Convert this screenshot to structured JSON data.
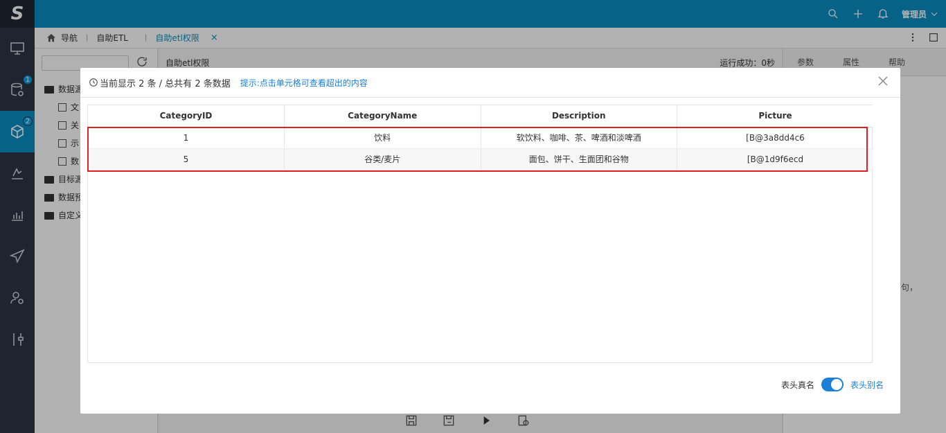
{
  "rail": {
    "logo": "S",
    "items": [
      {
        "icon": "monitor-icon",
        "badge": ""
      },
      {
        "icon": "database-settings-icon",
        "badge": "1"
      },
      {
        "icon": "cube-icon",
        "badge": "2",
        "active": true
      },
      {
        "icon": "chart-draw-icon",
        "badge": ""
      },
      {
        "icon": "bar-chart-icon",
        "badge": ""
      },
      {
        "icon": "send-icon",
        "badge": ""
      },
      {
        "icon": "user-settings-icon",
        "badge": ""
      },
      {
        "icon": "tools-icon",
        "badge": ""
      }
    ]
  },
  "topbar": {
    "user_label": "管理员"
  },
  "tabs": {
    "home_label": "导航",
    "items": [
      {
        "label": "自助ETL"
      },
      {
        "label": "自助etl权限",
        "active": true
      }
    ],
    "close_glyph": "×"
  },
  "left_pane": {
    "tree": [
      {
        "label": "数据源",
        "type": "folder"
      },
      {
        "label": "文",
        "type": "child"
      },
      {
        "label": "关",
        "type": "child"
      },
      {
        "label": "示",
        "type": "child"
      },
      {
        "label": "数",
        "type": "child"
      },
      {
        "label": "目标源",
        "type": "folder"
      },
      {
        "label": "数据预",
        "type": "folder"
      },
      {
        "label": "自定义",
        "type": "folder"
      }
    ]
  },
  "center_pane": {
    "title": "自助etl权限",
    "status": "运行成功：0秒"
  },
  "right_pane": {
    "tabs": [
      "参数",
      "属性",
      "帮助"
    ],
    "partial_text": "句，"
  },
  "modal": {
    "count_text": "当前显示 2 条 / 总共有 2 条数据",
    "tip_text": "提示:点击单元格可查看超出的内容",
    "columns": [
      "CategoryID",
      "CategoryName",
      "Description",
      "Picture"
    ],
    "rows": [
      [
        "1",
        "饮料",
        "软饮料、咖啡、茶、啤酒和淡啤酒",
        "[B@3a8dd4c6"
      ],
      [
        "5",
        "谷类/麦片",
        "面包、饼干、生面团和谷物",
        "[B@1d9f6ecd"
      ]
    ],
    "toggle_left_label": "表头真名",
    "toggle_right_label": "表头别名",
    "toggle_on": true
  },
  "colors": {
    "primary": "#0a8fc2",
    "rail_bg": "#2b3544",
    "highlight": "#e02020",
    "link": "#1a7fd6"
  }
}
